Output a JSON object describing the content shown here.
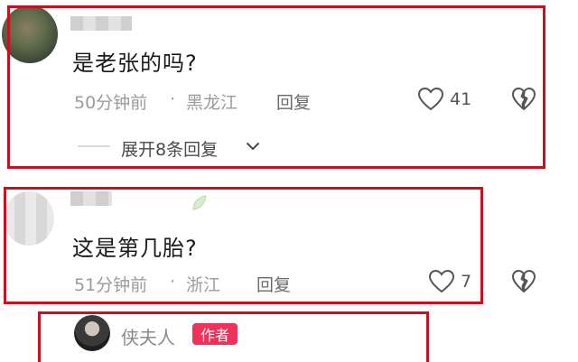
{
  "comments": [
    {
      "text": "是老张的吗?",
      "time": "50分钟前",
      "dot": "·",
      "location": "黑龙江",
      "reply_label": "回复",
      "likes": "41",
      "expand_label": "展开8条回复"
    },
    {
      "text": "这是第几胎?",
      "time": "51分钟前",
      "dot": "·",
      "location": "浙江",
      "reply_label": "回复",
      "likes": "7"
    }
  ],
  "author_reply": {
    "name": "侠夫人",
    "badge": "作者"
  },
  "colors": {
    "highlight_frame": "#c8101f",
    "author_badge": "#f0315a"
  },
  "icons": [
    "heart-icon",
    "broken-heart-icon",
    "chevron-down-icon"
  ]
}
